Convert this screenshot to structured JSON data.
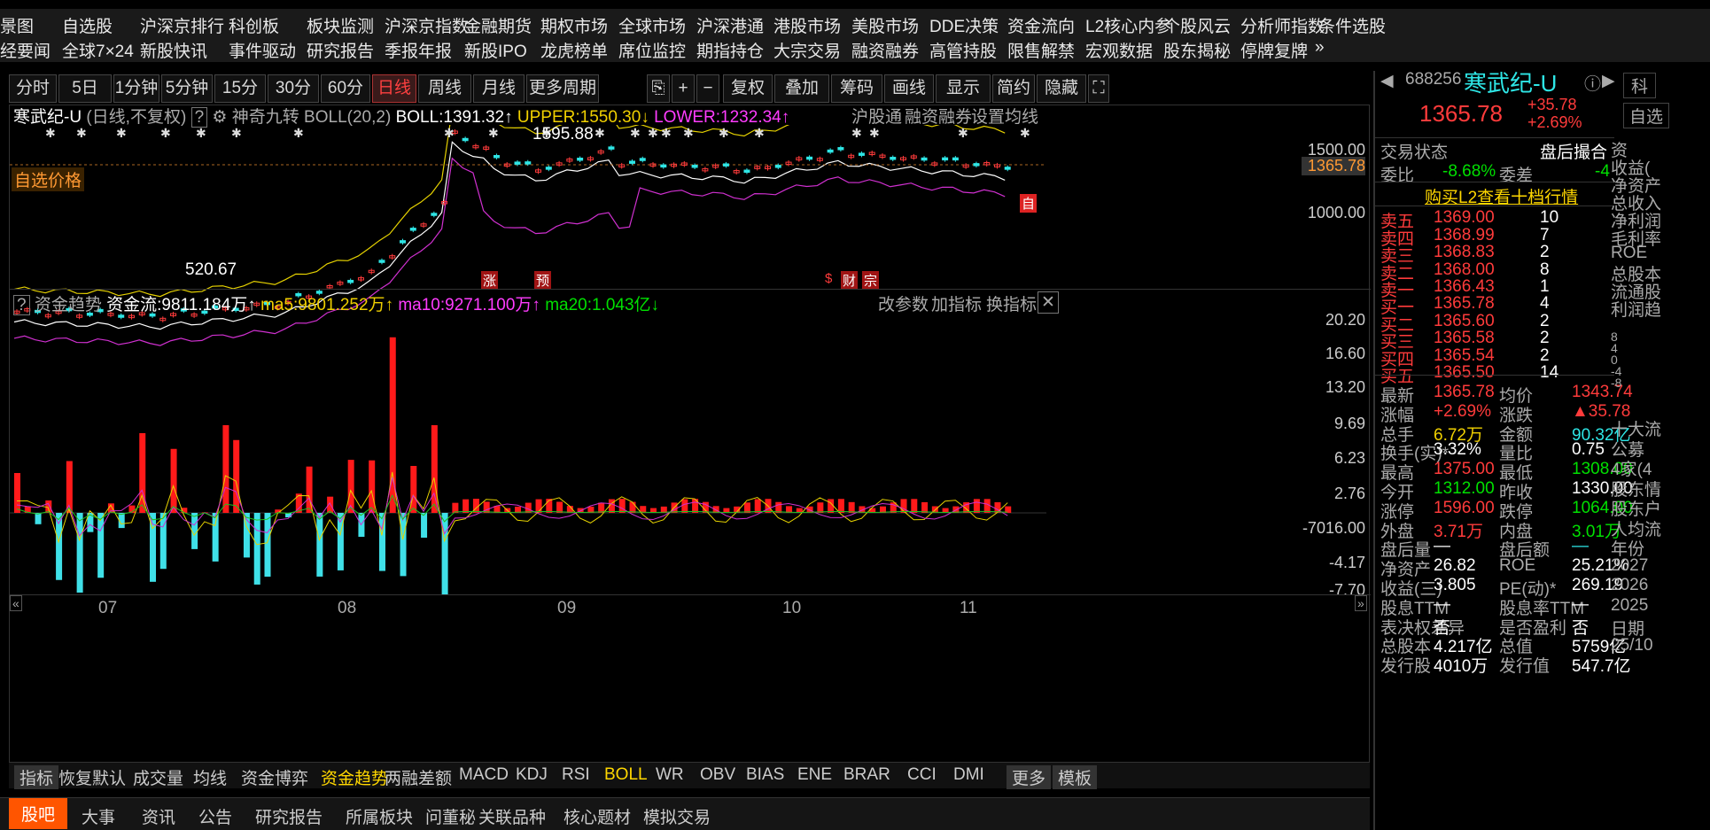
{
  "menu_row1": [
    "景图",
    "自选股",
    "沪深京排行",
    "科创板",
    "板块监测",
    "沪深京指数",
    "金融期货",
    "期权市场",
    "全球市场",
    "沪深港通",
    "港股市场",
    "美股市场",
    "DDE决策",
    "资金流向",
    "L2核心内参",
    "个股风云",
    "分析师指数",
    "条件选股"
  ],
  "menu_row2": [
    "经要闻",
    "全球7×24",
    "新股快讯",
    "事件驱动",
    "研究报告",
    "季报年报",
    "新股IPO",
    "龙虎榜单",
    "席位监控",
    "期指持仓",
    "大宗交易",
    "融资融券",
    "高管持股",
    "限售解禁",
    "宏观数据",
    "股东揭秘",
    "停牌复牌",
    "»"
  ],
  "toolbar": [
    "分时",
    "5日",
    "1分钟",
    "5分钟",
    "15分钟",
    "30分钟",
    "60分钟",
    "日线",
    "周线",
    "月线",
    "更多周期",
    "⎘",
    "+",
    "−",
    "复权",
    "叠加",
    "筹码",
    "画线",
    "显示",
    "简约",
    "隐藏 ▸▸",
    "⛶"
  ],
  "chart_header": {
    "name": "寒武纪-U",
    "mode": "(日线,不复权)",
    "help": "?",
    "indicator": "神奇九转",
    "boll_name": "BOLL(20,2)",
    "boll": "BOLL:1391.32",
    "upper": "UPPER:1550.30",
    "lower": "LOWER:1232.34",
    "links": [
      "沪股通",
      "融资融券",
      "设置均线"
    ]
  },
  "price_axis": [
    "1500.00",
    "1365.78",
    "1000.00"
  ],
  "annotations": {
    "high": "1595.88",
    "low": "520.67",
    "self_price": "自选价格",
    "self_mark": "自",
    "tags": [
      "涨",
      "预",
      "$",
      "财",
      "宗"
    ]
  },
  "flow_header": {
    "title": "资金趋势",
    "flow": "资金流:9811.184万",
    "ma5": "ma5:9801.252万",
    "ma10": "ma10:9271.100万",
    "ma20": "ma20:1.043亿",
    "links": [
      "改参数",
      "加指标",
      "换指标"
    ]
  },
  "flow_axis": [
    "20.20",
    "16.60",
    "13.20",
    "9.69",
    "6.23",
    "2.76",
    "-7016.00",
    "-4.17",
    "-7.70"
  ],
  "months": [
    "07",
    "08",
    "09",
    "10",
    "11"
  ],
  "indicator_tabs": [
    "指标",
    "恢复默认",
    "成交量",
    "均线",
    "资金博弈",
    "资金趋势",
    "两融差额",
    "MACD",
    "KDJ",
    "RSI",
    "BOLL",
    "WR",
    "OBV",
    "BIAS",
    "ENE",
    "BRAR",
    "CCI",
    "DMI",
    "更多",
    "模板"
  ],
  "bottom_tabs": [
    "股吧",
    "大事",
    "资讯",
    "公告",
    "研究报告",
    "所属板块",
    "问董秘",
    "关联品种",
    "核心题材",
    "模拟交易"
  ],
  "quote": {
    "code": "688256",
    "name": "寒武纪-U",
    "price": "1365.78",
    "change": "+35.78",
    "pct": "+2.69%",
    "status_label": "交易状态",
    "status": "盘后撮合",
    "wb_label": "委比",
    "wb": "-8.68%",
    "wc_label": "委差",
    "wc": "-4",
    "l2": "购买L2查看十档行情"
  },
  "asks": [
    [
      "卖五",
      "1369.00",
      "10"
    ],
    [
      "卖四",
      "1368.99",
      "7"
    ],
    [
      "卖三",
      "1368.83",
      "2"
    ],
    [
      "卖二",
      "1368.00",
      "8"
    ],
    [
      "卖一",
      "1366.43",
      "1"
    ]
  ],
  "bids": [
    [
      "买一",
      "1365.78",
      "4"
    ],
    [
      "买二",
      "1365.60",
      "2"
    ],
    [
      "买三",
      "1365.58",
      "2"
    ],
    [
      "买四",
      "1365.54",
      "2"
    ],
    [
      "买五",
      "1365.50",
      "14"
    ]
  ],
  "stats": [
    [
      "最新",
      "1365.78",
      "均价",
      "1343.74"
    ],
    [
      "涨幅",
      "+2.69%",
      "涨跌",
      "▲35.78"
    ],
    [
      "总手",
      "6.72万",
      "金额",
      "90.32亿"
    ],
    [
      "换手(实)*",
      "3.32%",
      "量比",
      "0.75"
    ],
    [
      "最高",
      "1375.00",
      "最低",
      "1308.00"
    ],
    [
      "今开",
      "1312.00",
      "昨收",
      "1330.00"
    ],
    [
      "涨停",
      "1596.00",
      "跌停",
      "1064.00"
    ],
    [
      "外盘",
      "3.71万",
      "内盘",
      "3.01万"
    ],
    [
      "盘后量",
      "—",
      "盘后额",
      "—"
    ],
    [
      "净资产",
      "26.82",
      "ROE",
      "25.21%"
    ],
    [
      "收益(三)",
      "3.805",
      "PE(动)*",
      "269.19"
    ],
    [
      "股息TTM",
      "—",
      "股息率TTM",
      "—"
    ],
    [
      "表决权差异",
      "否",
      "是否盈利",
      "否"
    ],
    [
      "总股本",
      "4.217亿",
      "总值",
      "5759亿"
    ],
    [
      "发行股",
      "4010万",
      "发行值",
      "547.7亿"
    ]
  ],
  "side": {
    "btn1": "科",
    "btn2": "自选",
    "col": [
      "资",
      "收益(",
      "净资产",
      "总收入",
      "净利润",
      "毛利率",
      "ROE",
      "总股本",
      "流通股",
      "利润趋"
    ],
    "axis": [
      "8",
      "4",
      "0",
      "-4",
      "-8"
    ],
    "more": [
      "十大流",
      "公募",
      "4家(4",
      "股东情",
      "股东户",
      "人均流",
      "年份",
      "2027",
      "2026",
      "2025",
      "日期",
      "25/10"
    ]
  }
}
